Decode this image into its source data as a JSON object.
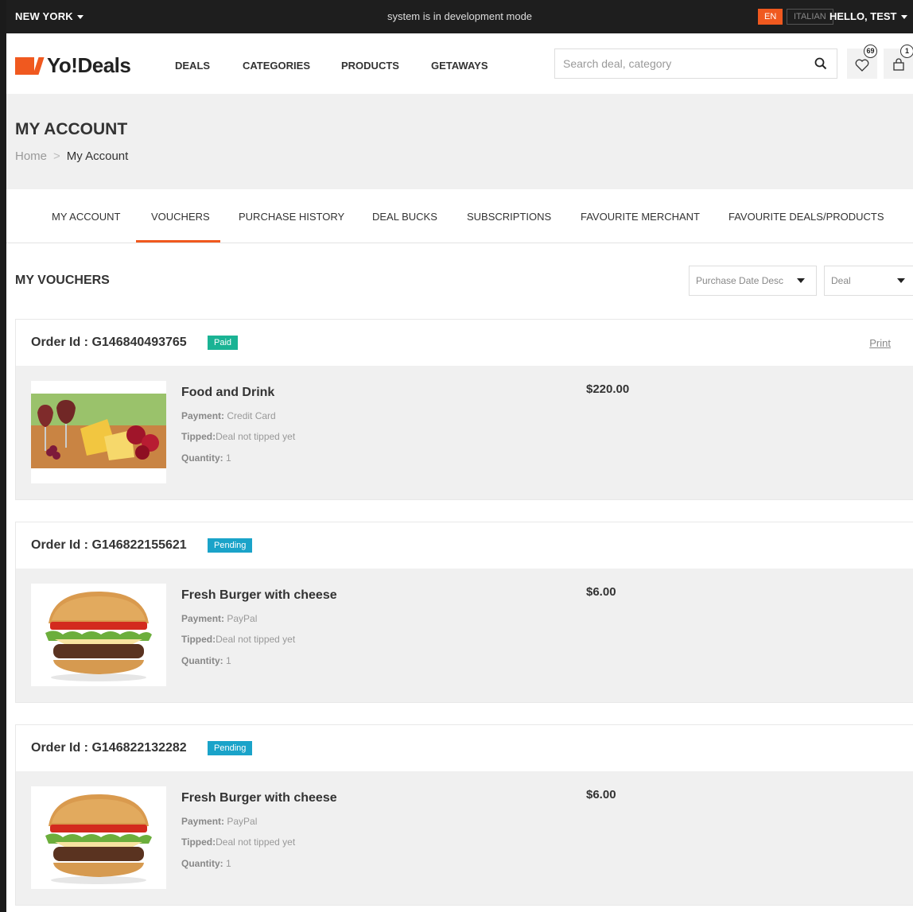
{
  "topbar": {
    "city": "NEW YORK",
    "dev_notice": "system is in development mode",
    "lang_en": "EN",
    "lang_it": "ITALIAN",
    "greeting": "HELLO, TEST"
  },
  "header": {
    "logo_text": "Yo!Deals",
    "nav": [
      "DEALS",
      "CATEGORIES",
      "PRODUCTS",
      "GETAWAYS"
    ],
    "search_placeholder": "Search deal, category",
    "wishlist_count": "69",
    "cart_count": "1"
  },
  "page": {
    "title": "MY ACCOUNT",
    "breadcrumb_home": "Home",
    "breadcrumb_current": "My Account"
  },
  "tabs": [
    "MY ACCOUNT",
    "VOUCHERS",
    "PURCHASE HISTORY",
    "DEAL BUCKS",
    "SUBSCRIPTIONS",
    "FAVOURITE MERCHANT",
    "FAVOURITE DEALS/PRODUCTS"
  ],
  "vouchers": {
    "heading": "MY VOUCHERS",
    "sort_value": "Purchase Date Desc",
    "type_value": "Deal",
    "print_label": "Print",
    "labels": {
      "payment": "Payment:",
      "tipped": "Tipped:",
      "quantity": "Quantity:"
    },
    "orders": [
      {
        "order_id": "Order Id : G146840493765",
        "status": "Paid",
        "title": "Food and Drink",
        "payment": "Credit Card",
        "tipped": "Deal not tipped yet",
        "quantity": "1",
        "price": "$220.00",
        "image": "food-and-drink"
      },
      {
        "order_id": "Order Id : G146822155621",
        "status": "Pending",
        "title": "Fresh Burger with cheese",
        "payment": "PayPal",
        "tipped": "Deal not tipped yet",
        "quantity": "1",
        "price": "$6.00",
        "image": "burger"
      },
      {
        "order_id": "Order Id : G146822132282",
        "status": "Pending",
        "title": "Fresh Burger with cheese",
        "payment": "PayPal",
        "tipped": "Deal not tipped yet",
        "quantity": "1",
        "price": "$6.00",
        "image": "burger"
      }
    ]
  },
  "colors": {
    "accent": "#f0591f",
    "paid": "#1ab394",
    "pending": "#1aa3c9",
    "topbar": "#1e1e1e"
  }
}
